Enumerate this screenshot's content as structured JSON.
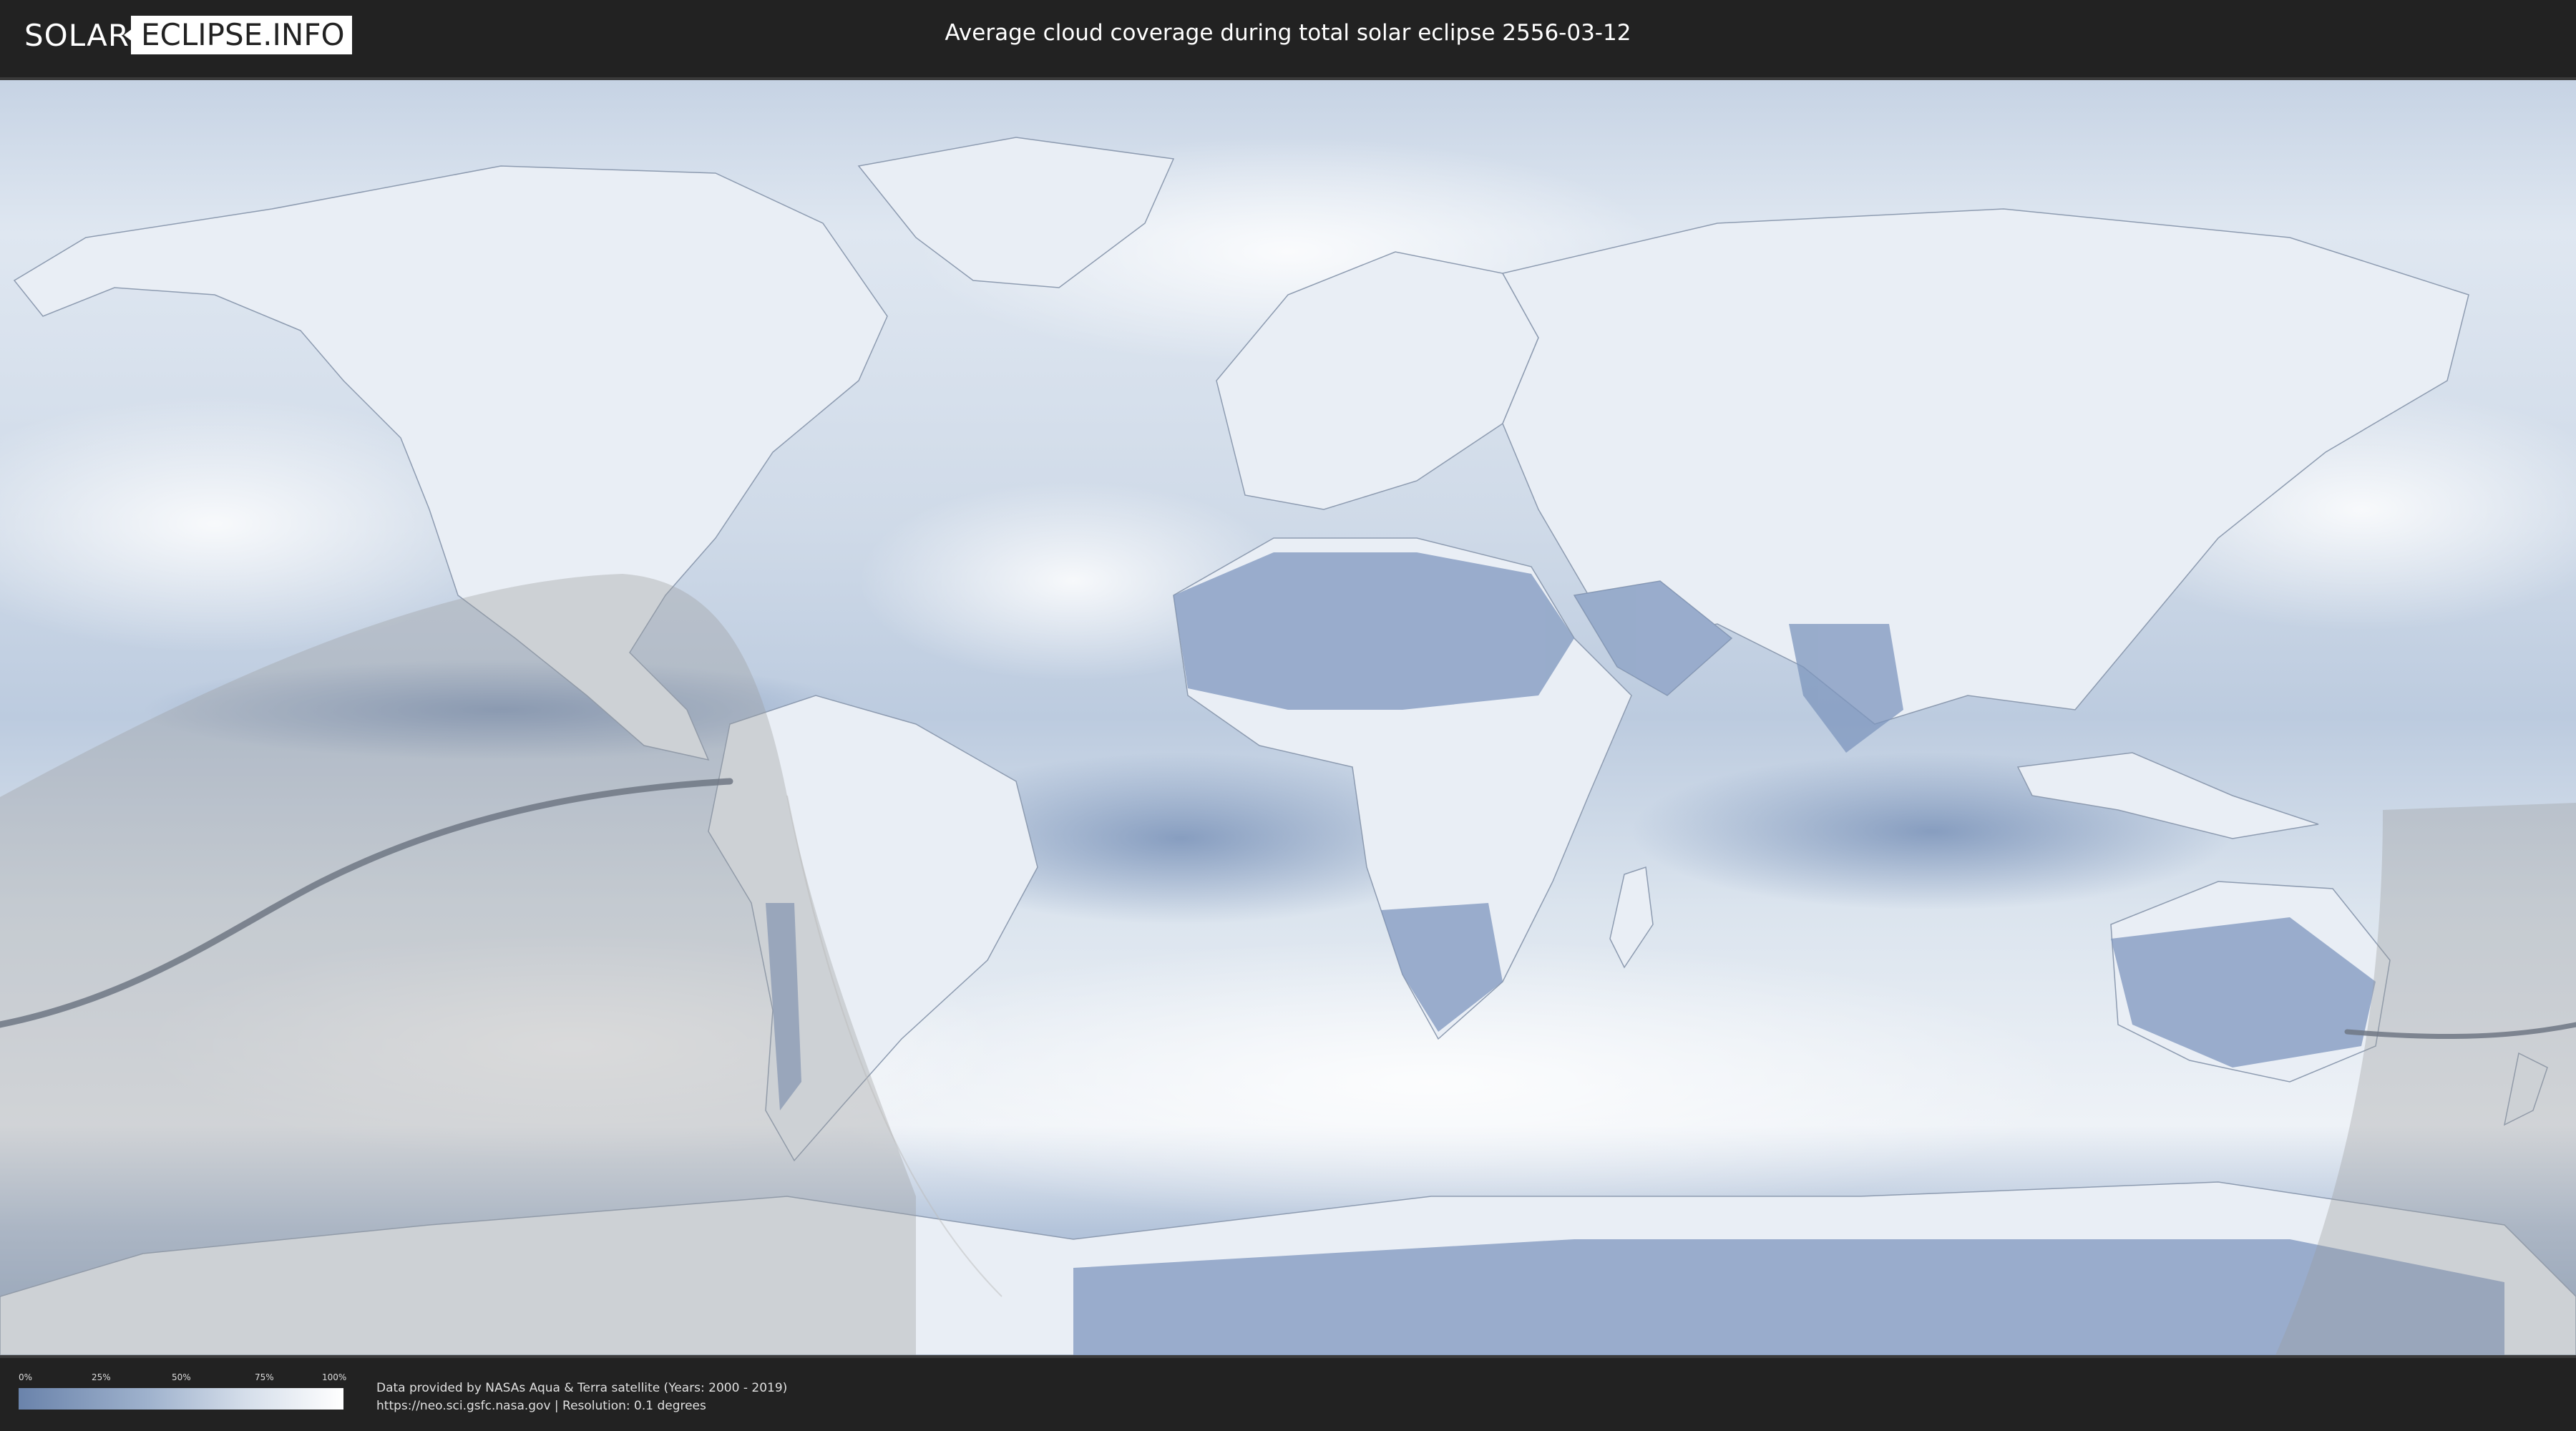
{
  "header": {
    "logo_left": "SOLAR",
    "logo_right": "ECLIPSE.INFO",
    "title": "Average cloud coverage during total solar eclipse 2556-03-12"
  },
  "legend": {
    "ticks": [
      "0%",
      "25%",
      "50%",
      "75%",
      "100%"
    ],
    "color_low": "#6a83ab",
    "color_high": "#ffffff"
  },
  "credits": {
    "line1": "Data provided by NASAs Aqua & Terra satellite (Years: 2000 - 2019)",
    "line2": "https://neo.sci.gsfc.nasa.gov | Resolution: 0.1 degrees"
  },
  "map": {
    "ocean_color": "#d6e0ec",
    "land_cloud_color": "#7f98bc",
    "shadow_color": "#9a9a9a",
    "path_color": "#666f7a"
  }
}
